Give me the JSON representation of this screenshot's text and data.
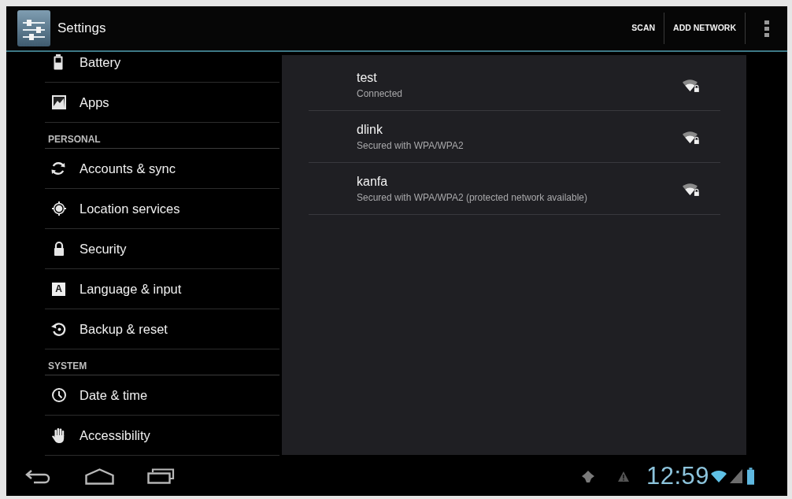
{
  "action_bar": {
    "title": "Settings",
    "actions": [
      {
        "label": "SCAN"
      },
      {
        "label": "ADD NETWORK"
      }
    ]
  },
  "sidebar": {
    "items": [
      {
        "kind": "item",
        "label": "Battery"
      },
      {
        "kind": "item",
        "label": "Apps"
      },
      {
        "kind": "header",
        "label": "PERSONAL"
      },
      {
        "kind": "item",
        "label": "Accounts & sync"
      },
      {
        "kind": "item",
        "label": "Location services"
      },
      {
        "kind": "item",
        "label": "Security"
      },
      {
        "kind": "item",
        "label": "Language & input",
        "glyph": "A"
      },
      {
        "kind": "item",
        "label": "Backup & reset"
      },
      {
        "kind": "header",
        "label": "SYSTEM"
      },
      {
        "kind": "item",
        "label": "Date & time"
      },
      {
        "kind": "item",
        "label": "Accessibility"
      }
    ]
  },
  "networks": [
    {
      "name": "test",
      "status": "Connected"
    },
    {
      "name": "dlink",
      "status": "Secured with WPA/WPA2"
    },
    {
      "name": "kanfa",
      "status": "Secured with WPA/WPA2 (protected network available)"
    }
  ],
  "status_bar": {
    "time": "12:59"
  }
}
